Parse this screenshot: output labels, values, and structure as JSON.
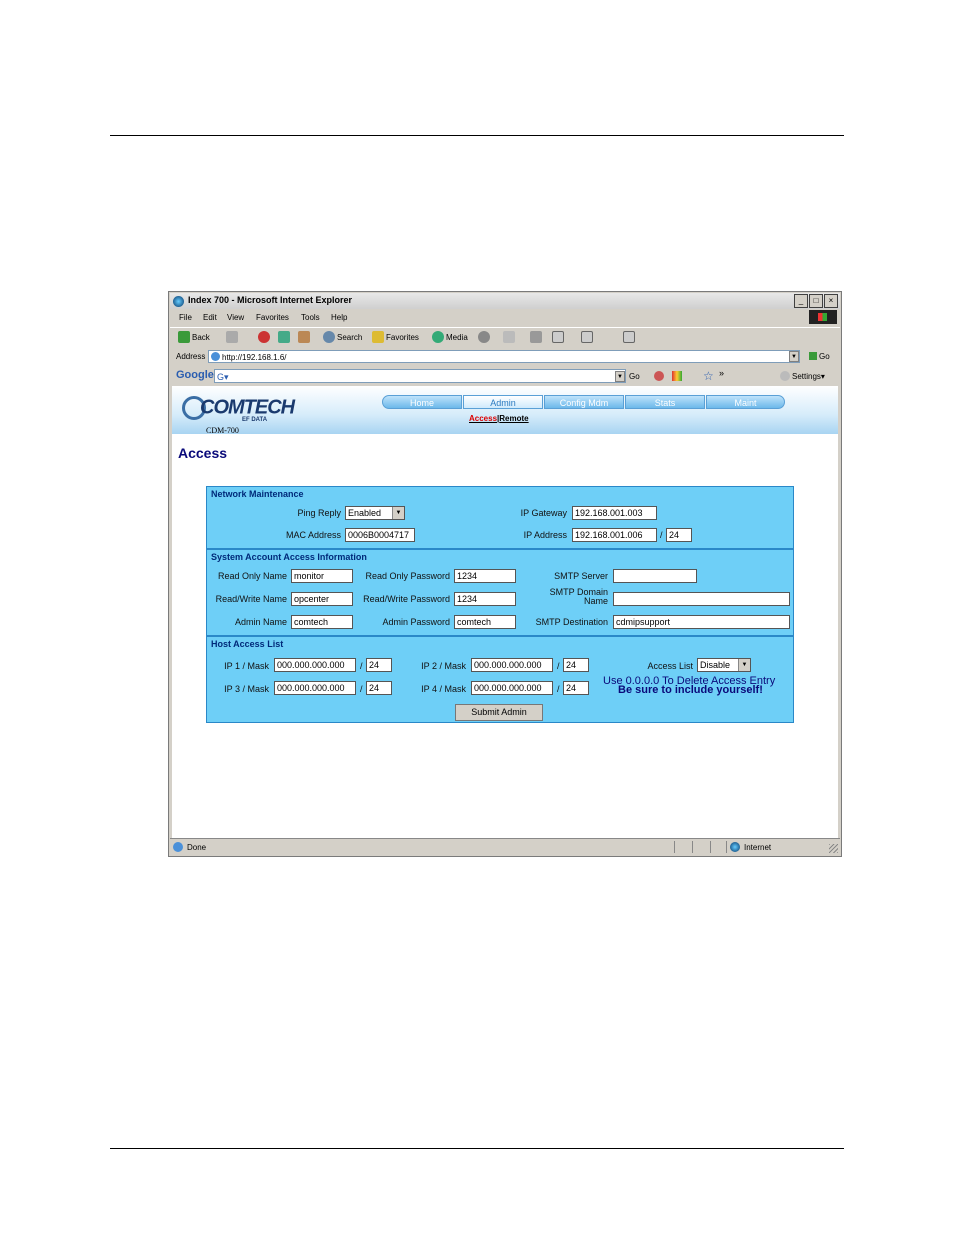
{
  "browser": {
    "title": "Index 700 - Microsoft Internet Explorer",
    "window_buttons": [
      "_",
      "□",
      "×"
    ],
    "menu": [
      "File",
      "Edit",
      "View",
      "Favorites",
      "Tools",
      "Help"
    ],
    "toolbar": {
      "back": "Back",
      "search": "Search",
      "favorites": "Favorites",
      "media": "Media"
    },
    "address_label": "Address",
    "address": "http://192.168.1.6/",
    "go": "Go",
    "google": {
      "logo": "Google",
      "box": "G▾",
      "go": "Go",
      "more": "»",
      "settings": "Settings▾"
    },
    "status": {
      "text": "Done",
      "zone": "Internet"
    }
  },
  "app": {
    "logo": "COMTECH",
    "logo_sub": "EF DATA",
    "model": "CDM-700",
    "nav": [
      "Home",
      "Admin",
      "Config Mdm",
      "Stats",
      "Maint"
    ],
    "active_nav": "Admin",
    "subnav": {
      "access": "Access",
      "sep": "|",
      "remote": "Remote"
    },
    "page_title": "Access"
  },
  "network": {
    "title": "Network Maintenance",
    "ping_label": "Ping Reply",
    "ping_value": "Enabled",
    "mac_label": "MAC Address",
    "mac_value": "0006B0004717",
    "gateway_label": "IP Gateway",
    "gateway_value": "192.168.001.003",
    "ip_label": "IP Address",
    "ip_value": "192.168.001.006",
    "mask_sep": "/",
    "mask_value": "24"
  },
  "accounts": {
    "title": "System Account Access Information",
    "ro_name_label": "Read Only Name",
    "ro_name": "monitor",
    "ro_pass_label": "Read Only Password",
    "ro_pass": "1234",
    "rw_name_label": "Read/Write Name",
    "rw_name": "opcenter",
    "rw_pass_label": "Read/Write Password",
    "rw_pass": "1234",
    "admin_name_label": "Admin Name",
    "admin_name": "comtech",
    "admin_pass_label": "Admin Password",
    "admin_pass": "comtech",
    "smtp_server_label": "SMTP Server",
    "smtp_server": "",
    "smtp_domain_label_1": "SMTP Domain",
    "smtp_domain_label_2": "Name",
    "smtp_domain": "",
    "smtp_dest_label": "SMTP Destination",
    "smtp_dest": "cdmipsupport"
  },
  "hosts": {
    "title": "Host Access List",
    "ip1_label": "IP 1 / Mask",
    "ip1": "000.000.000.000",
    "mask1": "24",
    "ip2_label": "IP 2 / Mask",
    "ip2": "000.000.000.000",
    "mask2": "24",
    "ip3_label": "IP 3 / Mask",
    "ip3": "000.000.000.000",
    "mask3": "24",
    "ip4_label": "IP 4 / Mask",
    "ip4": "000.000.000.000",
    "mask4": "24",
    "mask_sep": "/",
    "access_list_label": "Access List",
    "access_list_value": "Disable",
    "note1": "Use 0.0.0.0 To Delete Access Entry",
    "note2": "Be sure to include yourself!",
    "submit": "Submit Admin"
  }
}
